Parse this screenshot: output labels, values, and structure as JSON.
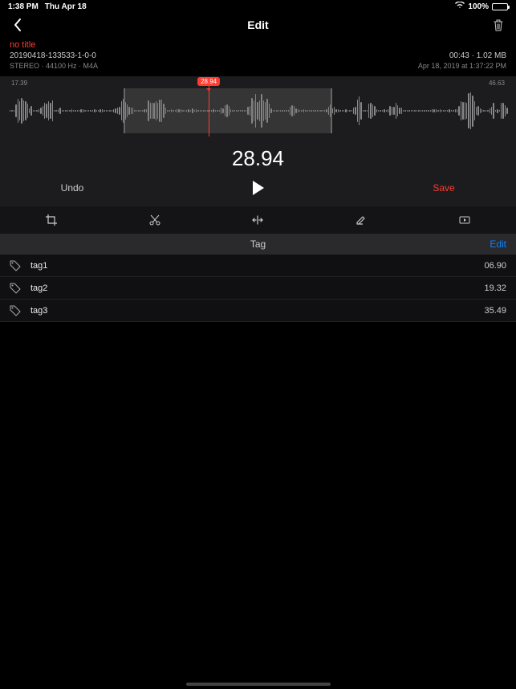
{
  "status": {
    "time": "1:38 PM",
    "date": "Thu Apr 18",
    "battery_pct": "100%"
  },
  "nav": {
    "title": "Edit"
  },
  "meta": {
    "title": "no title",
    "filename": "20190418-133533-1-0-0",
    "channels": "STEREO",
    "samplerate": "44100 Hz",
    "format": "M4A",
    "duration": "00:43",
    "filesize": "1.02 MB",
    "created": "Apr 18, 2019 at 1:37:22 PM"
  },
  "waveform": {
    "start_label": "17.39",
    "end_label": "46.63",
    "playhead": "28.94",
    "selection_start_pct": 23,
    "selection_end_pct": 65,
    "playhead_pct": 40
  },
  "big_time": "28.94",
  "transport": {
    "undo": "Undo",
    "save": "Save"
  },
  "tag_section": {
    "header": "Tag",
    "edit": "Edit",
    "tags": [
      {
        "name": "tag1",
        "time": "06.90"
      },
      {
        "name": "tag2",
        "time": "19.32"
      },
      {
        "name": "tag3",
        "time": "35.49"
      }
    ]
  }
}
